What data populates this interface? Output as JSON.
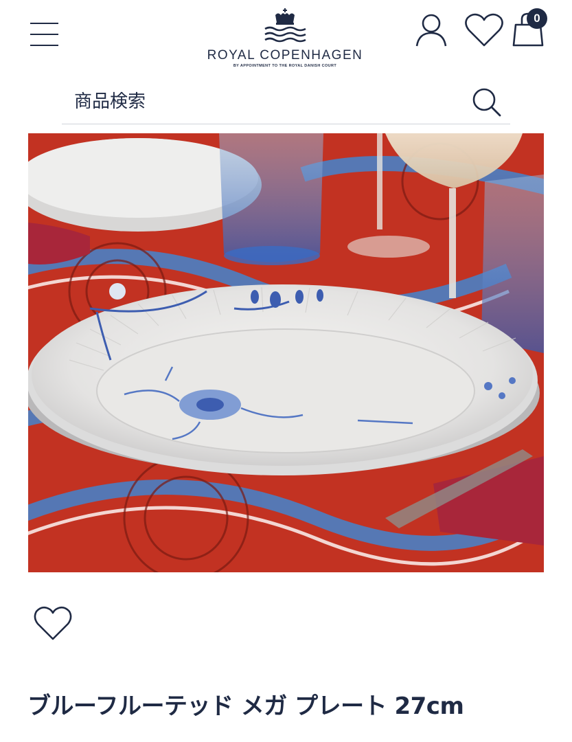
{
  "header": {
    "brand_name": "ROYAL COPENHAGEN",
    "brand_tagline": "BY APPOINTMENT TO THE ROYAL DANISH COURT",
    "cart_count": "0"
  },
  "search": {
    "placeholder": "商品検索"
  },
  "product": {
    "title": "ブルーフルーテッド メガ プレート 27cm"
  },
  "colors": {
    "brand_navy": "#1f2a44",
    "tablecloth_red": "#c23222",
    "tablecloth_blue": "#4a7fc4",
    "divider": "#cfd3d9"
  },
  "icons": {
    "menu": "hamburger-menu-icon",
    "logo": "crown-waves-logo",
    "account": "user-icon",
    "wishlist": "heart-icon",
    "cart": "shopping-bag-icon",
    "search": "magnifier-icon",
    "favorite": "heart-outline-icon"
  }
}
